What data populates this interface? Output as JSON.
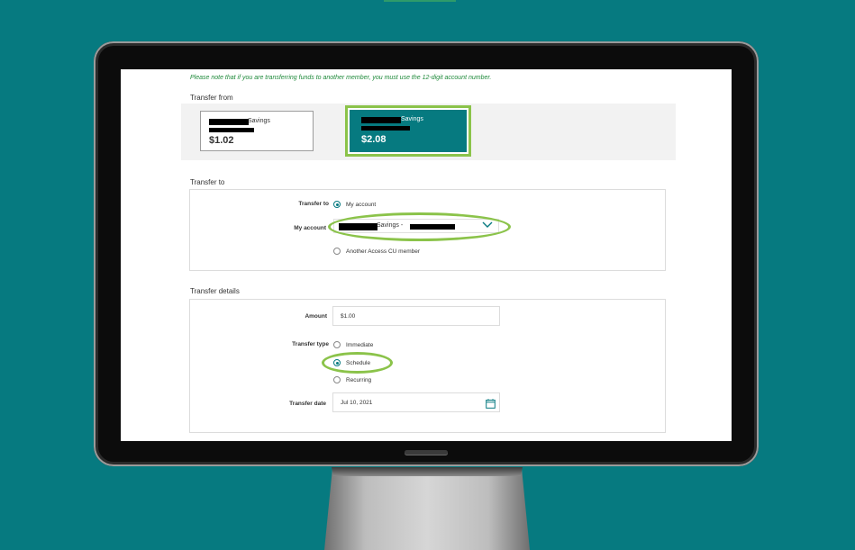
{
  "notice": "Please note that if you are transferring funds to another member, you must use the 12-digit account number.",
  "transfer_from": {
    "title": "Transfer from",
    "accounts": [
      {
        "name": "Savings",
        "amount": "$1.02",
        "selected": false
      },
      {
        "name": "Savings",
        "amount": "$2.08",
        "selected": true
      }
    ]
  },
  "transfer_to": {
    "title": "Transfer to",
    "transfer_to_label": "Transfer to",
    "option_my_account": "My account",
    "my_account_label": "My account",
    "my_account_value": "Savings -",
    "option_other_member": "Another Access CU member"
  },
  "transfer_details": {
    "title": "Transfer details",
    "amount_label": "Amount",
    "amount_value": "$1.00",
    "transfer_type_label": "Transfer type",
    "types": [
      "Immediate",
      "Schedule",
      "Recurring"
    ],
    "selected_type": "Schedule",
    "date_label": "Transfer date",
    "date_value": "Jul 10, 2021"
  },
  "colors": {
    "background": "#067a80",
    "accent": "#067a80",
    "highlight": "#8bc34a",
    "notice_text": "#1f8a3b"
  },
  "icons": {
    "dropdown": "chevron-down-icon",
    "date": "calendar-icon"
  }
}
